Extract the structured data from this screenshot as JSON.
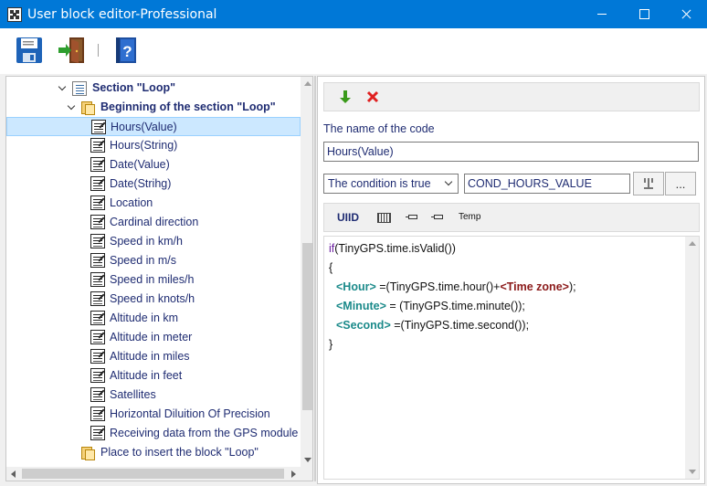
{
  "window": {
    "title": "User block editor-Professional"
  },
  "toolbar": {
    "save_icon": "floppy-disk-icon",
    "exit_icon": "exit-door-icon",
    "help_icon": "help-book-icon"
  },
  "tree": {
    "section": "Section \"Loop\"",
    "beginning": "Beginning of the section \"Loop\"",
    "items": [
      "Hours(Value)",
      "Hours(String)",
      "Date(Value)",
      "Date(Strihg)",
      "Location",
      "Cardinal direction",
      "Speed in km/h",
      "Speed in m/s",
      "Speed in miles/h",
      "Speed in knots/h",
      "Altitude in km",
      "Altitude in meter",
      "Altitude in miles",
      "Altitude in feet",
      "Satellites",
      "Horizontal Diluition Of Precision",
      "Receiving data from the GPS module"
    ],
    "selected_index": 0,
    "insert_place": "Place to insert the block \"Loop\""
  },
  "editor": {
    "code_name_label": "The name of the code",
    "code_name_value": "Hours(Value)",
    "condition_selected": "The condition is true",
    "condition_value": "COND_HOURS_VALUE",
    "more_label": "...",
    "uiid_label": "UIID",
    "temp_label": "Temp",
    "code": {
      "l1_kw": "if",
      "l1_rest": "(TinyGPS.time.isValid())",
      "l2": "{",
      "l3_var": "<Hour>",
      "l3_mid": " =(TinyGPS.time.hour()+",
      "l3_var2": "<Time zone>",
      "l3_end": ");",
      "l4_var": "<Minute>",
      "l4_rest": " = (TinyGPS.time.minute());",
      "l5_var": "<Second>",
      "l5_rest": " =(TinyGPS.time.second());",
      "l6": "}"
    }
  },
  "colors": {
    "titlebar": "#0078d7",
    "tree_text": "#1f2c72",
    "selection": "#cce8ff",
    "code_var": "#1b8a8a",
    "code_var2": "#8b1a1a",
    "code_keyword": "#6b1fa0"
  }
}
